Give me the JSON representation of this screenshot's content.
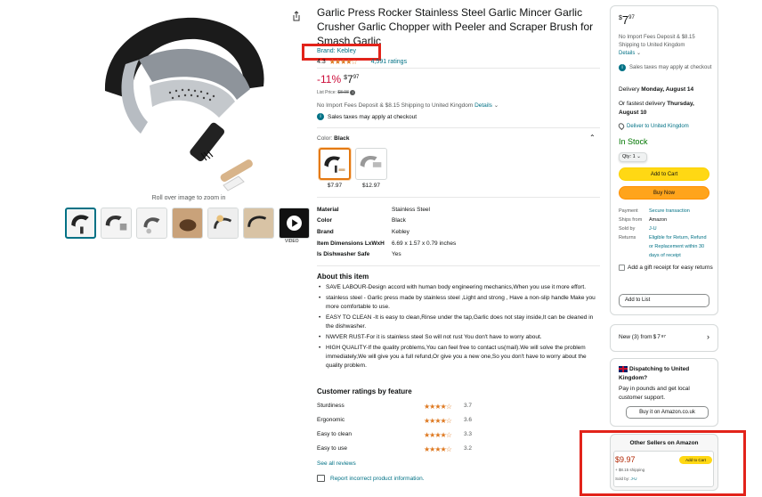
{
  "gallery": {
    "zoom_hint": "Roll over image to zoom in",
    "video_label": "VIDEO"
  },
  "product": {
    "title": "Garlic Press Rocker Stainless Steel Garlic Mincer Garlic Crusher Garlic Chopper with Peeler and Scraper Brush for Smash Garlic",
    "brand": "Brand: Kebley",
    "rating_value": "4.3",
    "rating_stars": "★★★★☆",
    "ratings_count": "4,591 ratings"
  },
  "price": {
    "discount": "-11%",
    "symbol": "$",
    "whole": "7",
    "fraction": "97",
    "list_label": "List Price:",
    "list_value": "$8.98",
    "import_note": "No Import Fees Deposit & $8.15 Shipping to United Kingdom",
    "details": "Details",
    "tax_note": "Sales taxes may apply at checkout"
  },
  "color": {
    "label": "Color:",
    "value": "Black",
    "options": [
      {
        "price": "$7.97"
      },
      {
        "price": "$12.97"
      }
    ]
  },
  "specs": [
    {
      "key": "Material",
      "value": "Stainless Steel"
    },
    {
      "key": "Color",
      "value": "Black"
    },
    {
      "key": "Brand",
      "value": "Kebley"
    },
    {
      "key": "Item Dimensions LxWxH",
      "value": "6.69 x 1.57 x 0.79 inches"
    },
    {
      "key": "Is Dishwasher Safe",
      "value": "Yes"
    }
  ],
  "about": {
    "heading": "About this item",
    "bullets": [
      "SAVE LABOUR-Design accord with human body engineering mechanics,When you use it more effort.",
      "stainless steel - Garlic press made by stainless steel ,Light and strong , Have a non-slip handle Make you more comfortable to use.",
      "EASY TO CLEAN -It is easy to clean,Rinse under the tap,Garlic does not stay inside,It can be cleaned in the dishwasher.",
      "NWVER RUST-For it is stainless steel So will not rust You don't have to worry about.",
      "HIGH QUALITY-If the quality problems,You can feel free to contact us(mail).We will solve the problem immediately,We will give you a full refund,Or give you a new one,So you don't have to worry about the quality problem."
    ]
  },
  "feature_ratings": {
    "heading": "Customer ratings by feature",
    "items": [
      {
        "name": "Sturdiness",
        "stars": "★★★★☆",
        "value": "3.7"
      },
      {
        "name": "Ergonomic",
        "stars": "★★★★☆",
        "value": "3.6"
      },
      {
        "name": "Easy to clean",
        "stars": "★★★★☆",
        "value": "3.3"
      },
      {
        "name": "Easy to use",
        "stars": "★★★★☆",
        "value": "3.2"
      }
    ],
    "see_all": "See all reviews",
    "report": "Report incorrect product information."
  },
  "buybox": {
    "price_symbol": "$",
    "price_whole": "7",
    "price_fraction": "97",
    "import_note": "No Import Fees Deposit & $8.15 Shipping to United Kingdom",
    "details": "Details",
    "tax_note": "Sales taxes may apply at checkout",
    "delivery_prefix": "Delivery",
    "delivery_date": "Monday, August 14",
    "fastest_prefix": "Or fastest delivery",
    "fastest_date": "Thursday, August 10",
    "deliver_to": "Deliver to United Kingdom",
    "stock": "In Stock",
    "qty": "Qty: 1",
    "add_to_cart": "Add to Cart",
    "buy_now": "Buy Now",
    "info": [
      {
        "key": "Payment",
        "value": "Secure transaction"
      },
      {
        "key": "Ships from",
        "value": "Amazon"
      },
      {
        "key": "Sold by",
        "value": "J-U"
      },
      {
        "key": "Returns",
        "value": "Eligible for Return, Refund or Replacement within 30 days of receipt"
      }
    ],
    "gift_label": "Add a gift receipt for easy returns",
    "add_to_list": "Add to List"
  },
  "new_offers": {
    "label": "New (3) from",
    "symbol": "$",
    "whole": "7",
    "fraction": "97"
  },
  "dispatch": {
    "heading": "Dispatching to United Kingdom?",
    "body": "Pay in pounds and get local customer support.",
    "button": "Buy it on Amazon.co.uk"
  },
  "other_sellers": {
    "heading": "Other Sellers on Amazon",
    "price": "$9.97",
    "add": "Add to Cart",
    "shipping": "+ $8.15 shipping",
    "sold_prefix": "Sold by:",
    "seller": "J-U"
  },
  "colors": {
    "link": "#007185",
    "deal_red": "#cc0c39",
    "stock_green": "#007600",
    "cart_yellow": "#ffd814",
    "buy_orange": "#ffa41c",
    "annotation_red": "#e2231a"
  }
}
